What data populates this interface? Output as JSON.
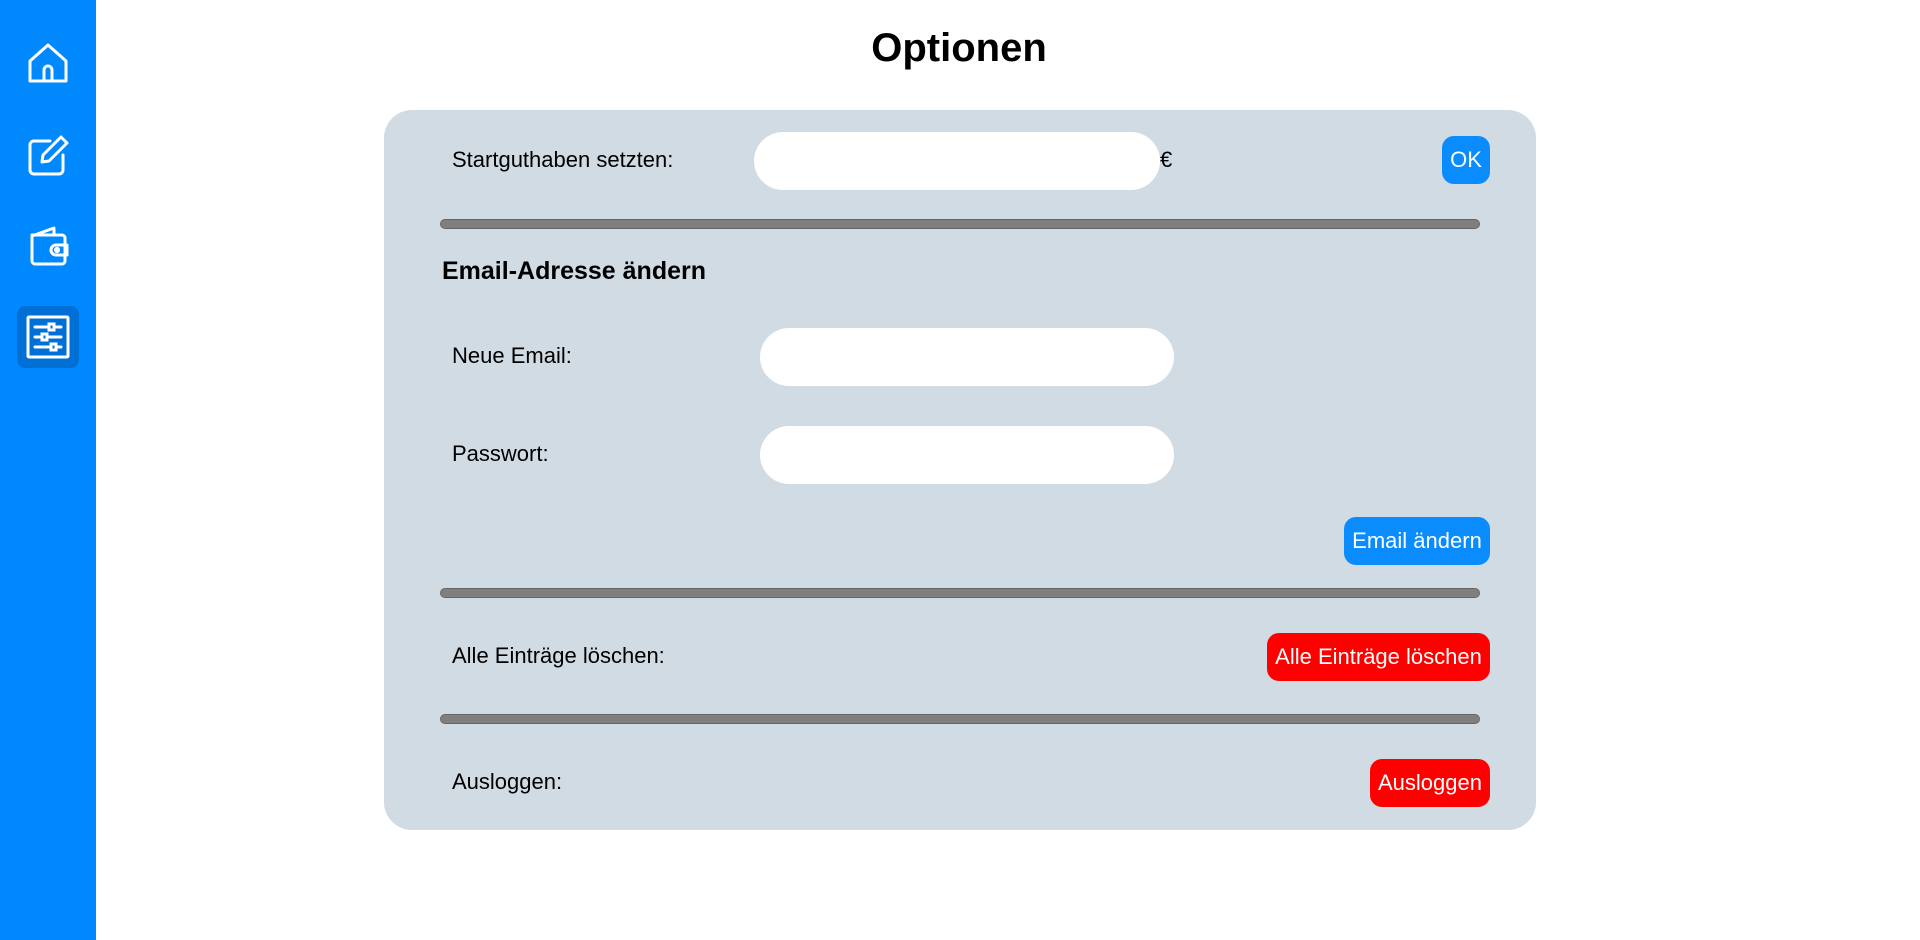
{
  "sidebar": {
    "items": [
      {
        "icon": "home-icon",
        "active": false
      },
      {
        "icon": "edit-icon",
        "active": false
      },
      {
        "icon": "wallet-icon",
        "active": false
      },
      {
        "icon": "settings-sliders-icon",
        "active": true
      }
    ]
  },
  "page": {
    "title": "Optionen"
  },
  "start_balance": {
    "label": "Startguthaben setzten:",
    "value": "",
    "currency": "€",
    "ok_label": "OK"
  },
  "email_section": {
    "title": "Email-Adresse ändern",
    "new_email_label": "Neue Email:",
    "new_email_value": "",
    "password_label": "Passwort:",
    "password_value": "",
    "submit_label": "Email ändern"
  },
  "delete_all": {
    "label": "Alle Einträge löschen:",
    "button_label": "Alle Einträge löschen"
  },
  "logout": {
    "label": "Ausloggen:",
    "button_label": "Ausloggen"
  },
  "colors": {
    "sidebar": "#0088ff",
    "card": "#d0dbe4",
    "primary_button": "#0a8cff",
    "danger_button": "#ff0000",
    "divider": "#7f7f7f"
  }
}
